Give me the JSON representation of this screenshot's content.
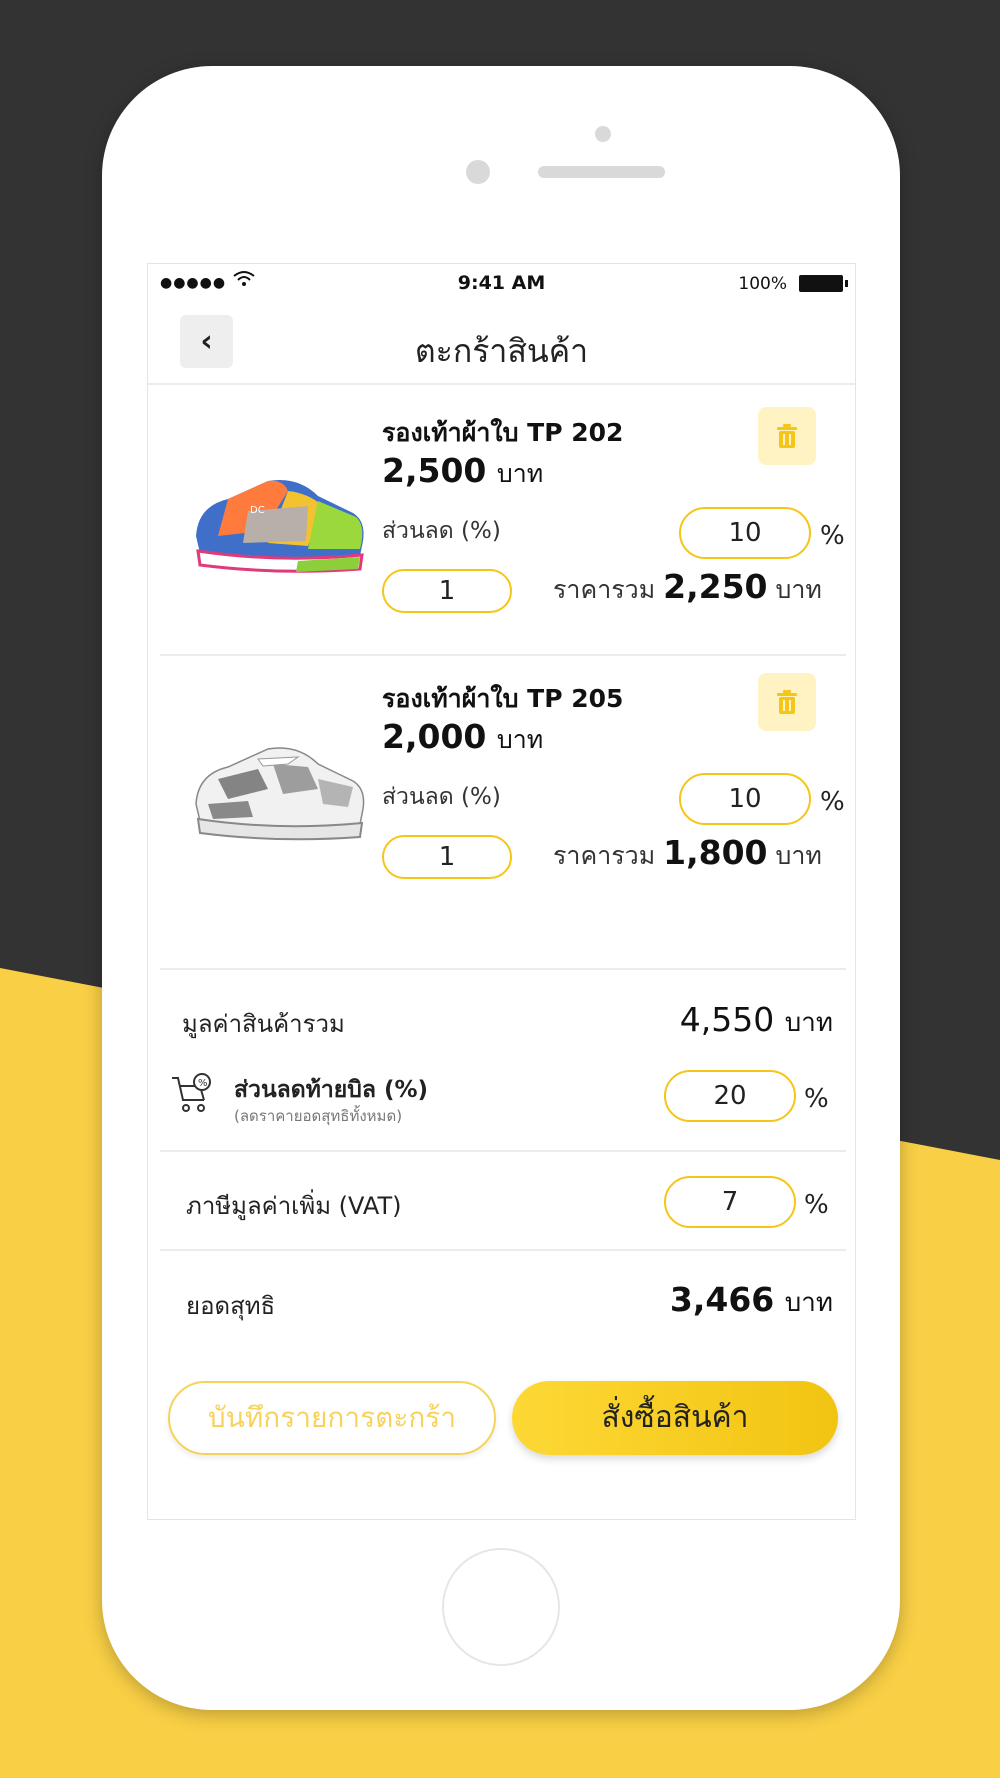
{
  "statusbar": {
    "signal": "●●●●●",
    "time": "9:41 AM",
    "battery_pct": "100%"
  },
  "nav": {
    "back_icon": "‹",
    "title": "ตะกร้าสินค้า"
  },
  "items": [
    {
      "name": "รองเท้าผ้าใบ TP 202",
      "price": "2,500",
      "currency": "บาท",
      "discount_label": "ส่วนลด (%)",
      "discount_value": "10",
      "percent": "%",
      "quantity": "1",
      "total_label": "ราคารวม",
      "total_value": "2,250",
      "total_currency": "บาท"
    },
    {
      "name": "รองเท้าผ้าใบ TP 205",
      "price": "2,000",
      "currency": "บาท",
      "discount_label": "ส่วนลด (%)",
      "discount_value": "10",
      "percent": "%",
      "quantity": "1",
      "total_label": "ราคารวม",
      "total_value": "1,800",
      "total_currency": "บาท"
    }
  ],
  "summary": {
    "subtotal_label": "มูลค่าสินค้ารวม",
    "subtotal_value": "4,550",
    "subtotal_currency": "บาท",
    "bill_discount_label": "ส่วนลดท้ายบิล (%)",
    "bill_discount_note": "(ลดราคายอดสุทธิทั้งหมด)",
    "bill_discount_value": "20",
    "bill_discount_percent": "%",
    "vat_label": "ภาษีมูลค่าเพิ่ม (VAT)",
    "vat_value": "7",
    "vat_percent": "%",
    "net_label": "ยอดสุทธิ",
    "net_value": "3,466",
    "net_currency": "บาท"
  },
  "actions": {
    "save_label": "บันทึกรายการตะกร้า",
    "order_label": "สั่งซื้อสินค้า"
  },
  "colors": {
    "accent": "#f5c518",
    "background_dark": "#333333",
    "background_yellow": "#f8cf45"
  }
}
